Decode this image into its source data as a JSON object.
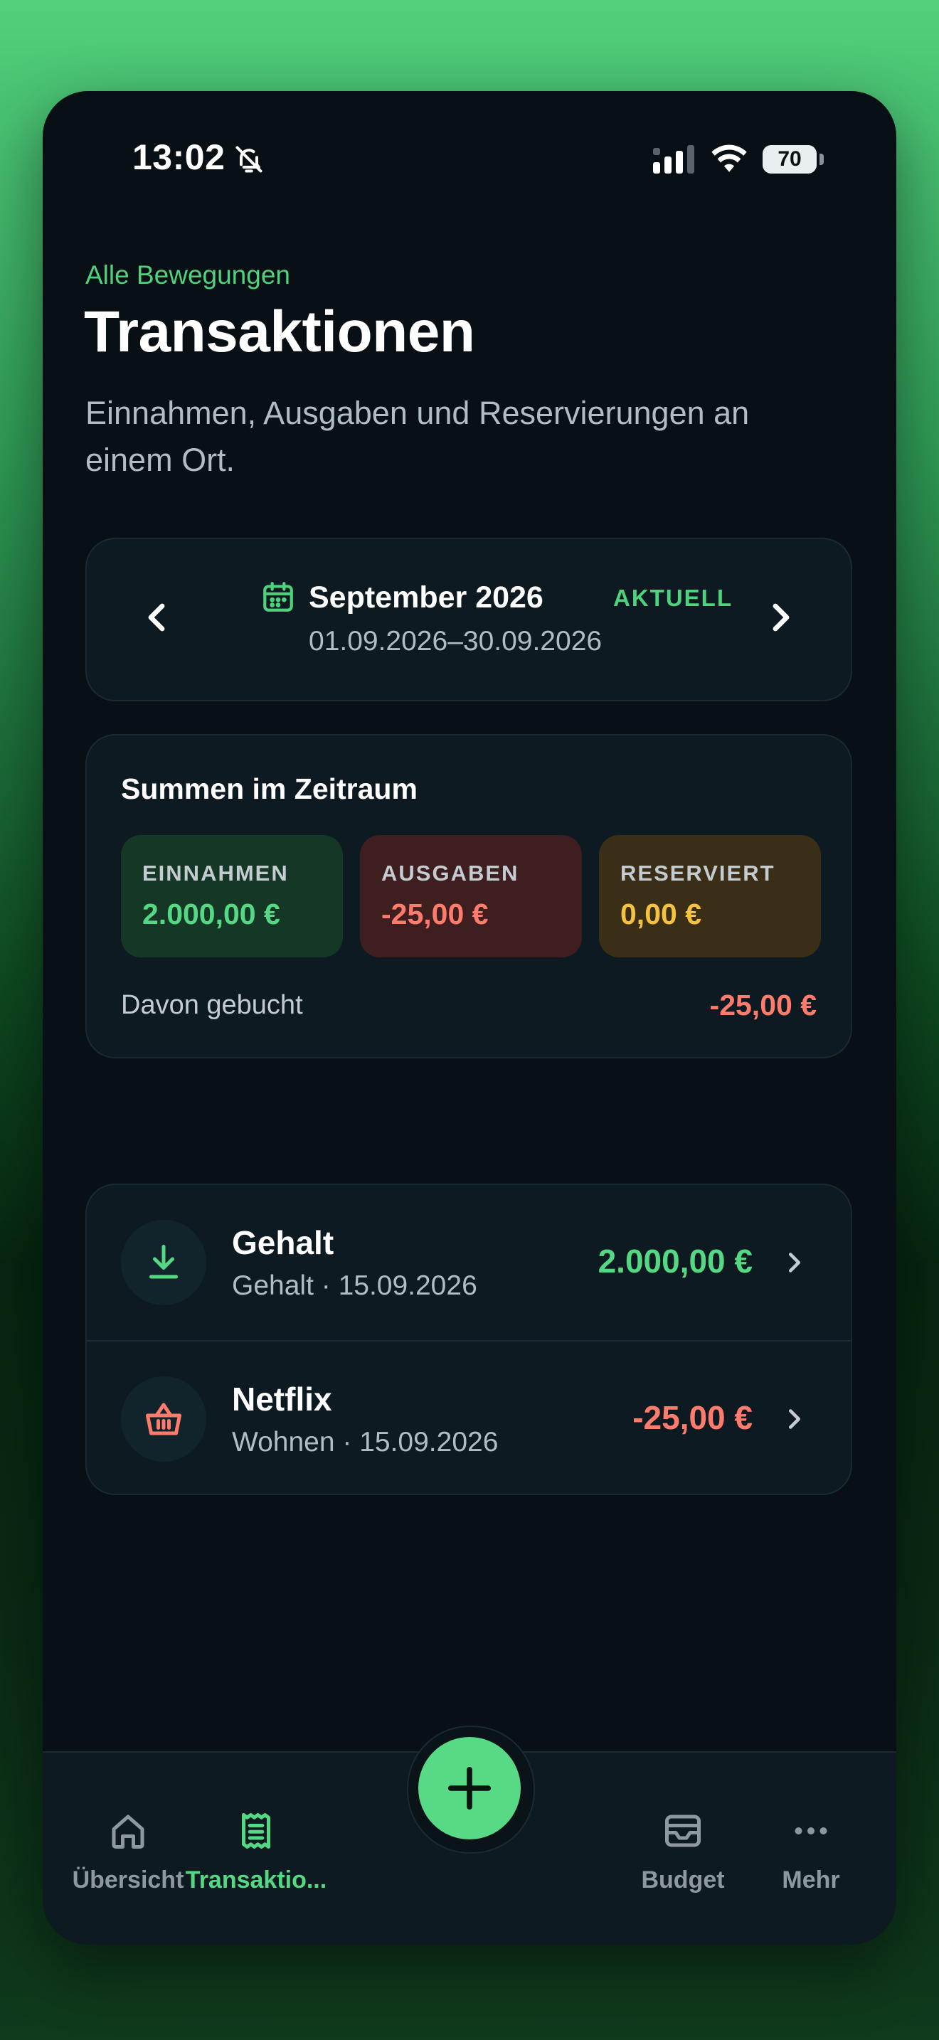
{
  "status_bar": {
    "time": "13:02",
    "battery": "70"
  },
  "header": {
    "eyebrow": "Alle Bewegungen",
    "title": "Transaktionen",
    "subtitle": "Einnahmen, Ausgaben und Reservierungen an einem Ort."
  },
  "period": {
    "label": "September 2026",
    "badge": "AKTUELL",
    "range": "01.09.2026–30.09.2026"
  },
  "totals": {
    "title": "Summen im Zeitraum",
    "income": {
      "label": "EINNAHMEN",
      "value": "2.000,00 €"
    },
    "expenses": {
      "label": "AUSGABEN",
      "value": "-25,00 €"
    },
    "reserved": {
      "label": "RESERVIERT",
      "value": "0,00 €"
    },
    "booked_label": "Davon gebucht",
    "booked_value": "-25,00 €"
  },
  "transactions": [
    {
      "name": "Gehalt",
      "meta": "Gehalt · 15.09.2026",
      "amount": "2.000,00 €",
      "icon": "download-icon"
    },
    {
      "name": "Netflix",
      "meta": "Wohnen · 15.09.2026",
      "amount": "-25,00 €",
      "icon": "basket-icon"
    }
  ],
  "tabs": [
    {
      "label": "Übersicht",
      "icon": "home-icon"
    },
    {
      "label": "Transaktio...",
      "icon": "receipt-icon",
      "active": true
    },
    {
      "label": "Budget",
      "icon": "inbox-icon"
    },
    {
      "label": "Mehr",
      "icon": "more-icon"
    }
  ],
  "colors": {
    "accent": "#54d884",
    "negative": "#ff7b6b",
    "reserved": "#f5c23f",
    "background": "#080f15",
    "card": "#0e1a21"
  }
}
